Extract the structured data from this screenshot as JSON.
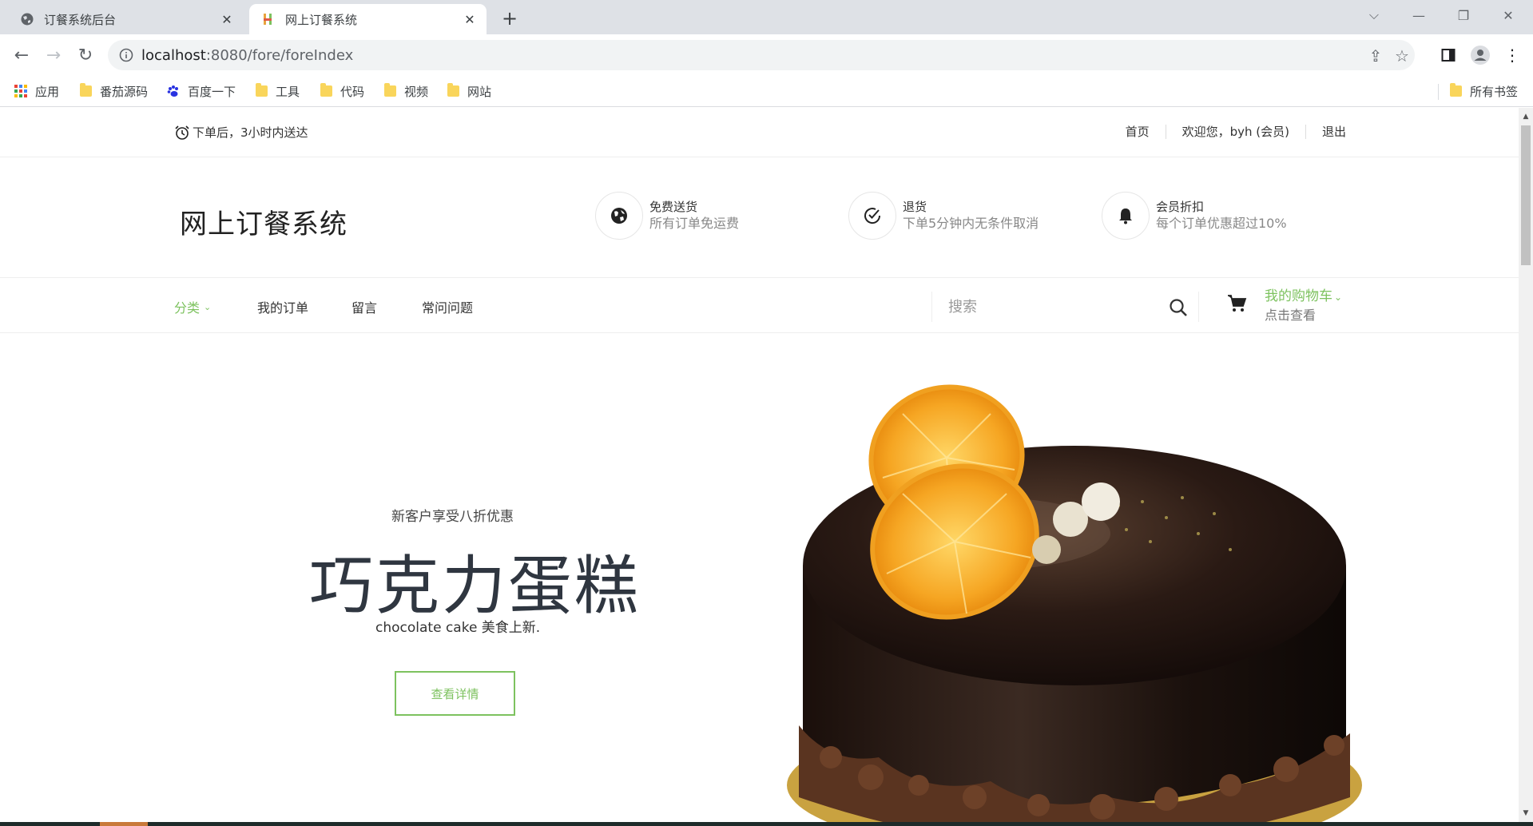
{
  "browser": {
    "tabs": [
      {
        "title": "订餐系统后台",
        "icon": "globe-icon",
        "active": false
      },
      {
        "title": "网上订餐系统",
        "icon": "site-favicon",
        "active": true
      }
    ],
    "url_host": "localhost",
    "url_rest": ":8080/fore/foreIndex",
    "bookmarks": [
      {
        "label": "应用",
        "icon": "apps-grid-icon"
      },
      {
        "label": "番茄源码",
        "icon": "folder-icon"
      },
      {
        "label": "百度一下",
        "icon": "baidu-paw-icon"
      },
      {
        "label": "工具",
        "icon": "folder-icon"
      },
      {
        "label": "代码",
        "icon": "folder-icon"
      },
      {
        "label": "视频",
        "icon": "folder-icon"
      },
      {
        "label": "网站",
        "icon": "folder-icon"
      }
    ],
    "all_bookmarks": "所有书签"
  },
  "topbar": {
    "delivery_promise": "下单后，3小时内送达",
    "links": [
      "首页",
      "欢迎您，byh (会员)",
      "退出"
    ]
  },
  "header": {
    "logo": "网上订餐系统",
    "features": [
      {
        "title": "免费送货",
        "desc": "所有订单免运费",
        "icon": "globe-icon"
      },
      {
        "title": "退货",
        "desc": "下单5分钟内无条件取消",
        "icon": "check-circle-icon"
      },
      {
        "title": "会员折扣",
        "desc": "每个订单优惠超过10%",
        "icon": "bell-icon"
      }
    ]
  },
  "nav": {
    "category": "分类",
    "items": [
      "我的订单",
      "留言",
      "常问问题"
    ],
    "search_placeholder": "搜索",
    "cart_title": "我的购物车",
    "cart_sub": "点击查看"
  },
  "hero": {
    "subtitle": "新客户享受八折优惠",
    "title": "巧克力蛋糕",
    "desc": "chocolate cake 美食上新.",
    "button": "查看详情"
  },
  "colors": {
    "accent": "#7dc25f",
    "chrome_bg": "#dee1e6"
  }
}
